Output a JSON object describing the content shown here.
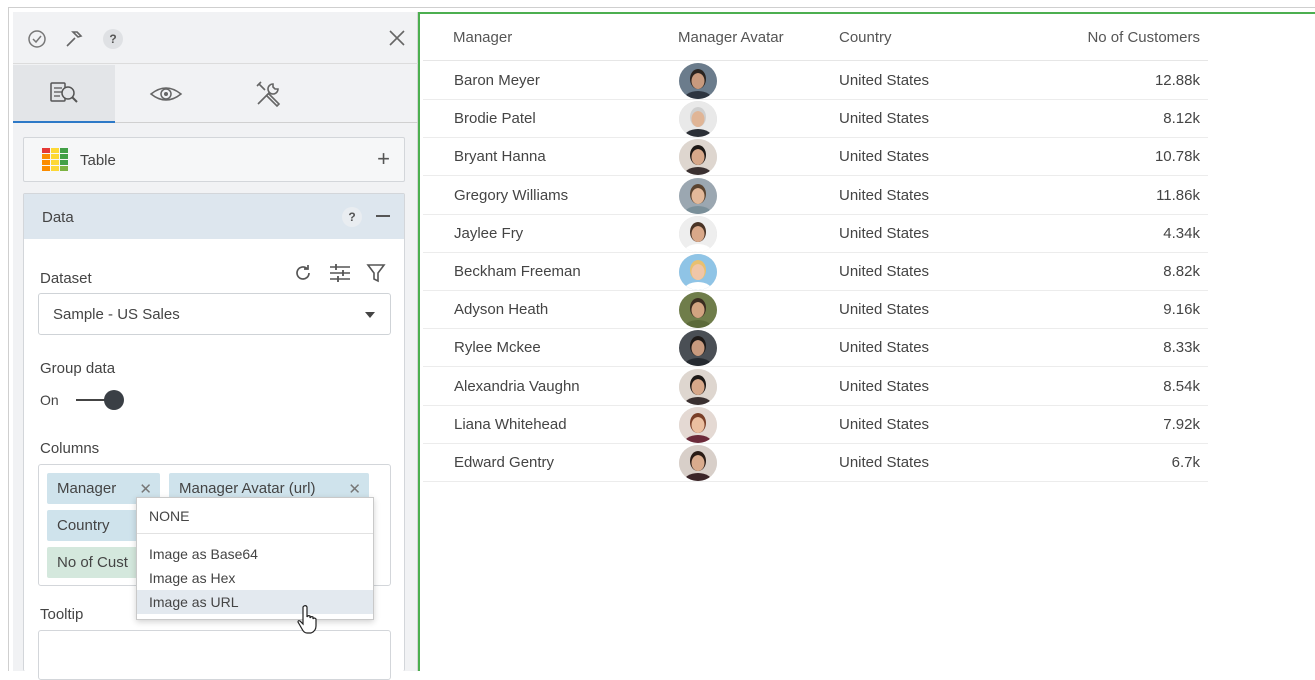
{
  "editor": {
    "table_card_label": "Table",
    "data_section_label": "Data",
    "data_help": "?",
    "topbar_help": "?",
    "dataset_label": "Dataset",
    "dataset_value": "Sample - US Sales",
    "group_data_label": "Group data",
    "group_data_state": "On",
    "columns_label": "Columns",
    "column_chips": [
      "Manager",
      "Manager Avatar (url)",
      "Country",
      "No of Cust"
    ],
    "tooltip_label": "Tooltip",
    "dropdown_menu": {
      "items": [
        "NONE",
        "Image as Base64",
        "Image as Hex",
        "Image as URL"
      ],
      "highlighted": "Image as URL"
    }
  },
  "table": {
    "headers": [
      "Manager",
      "Manager Avatar",
      "Country",
      "No of Customers"
    ],
    "rows": [
      {
        "manager": "Baron Meyer",
        "country": "United States",
        "customers": "12.88k",
        "avatar": "man-dark-suit"
      },
      {
        "manager": "Brodie Patel",
        "country": "United States",
        "customers": "8.12k",
        "avatar": "man-grey-hair"
      },
      {
        "manager": "Bryant Hanna",
        "country": "United States",
        "customers": "10.78k",
        "avatar": "woman-dark-hair"
      },
      {
        "manager": "Gregory Williams",
        "country": "United States",
        "customers": "11.86k",
        "avatar": "man-smiling"
      },
      {
        "manager": "Jaylee Fry",
        "country": "United States",
        "customers": "4.34k",
        "avatar": "man-beard"
      },
      {
        "manager": "Beckham Freeman",
        "country": "United States",
        "customers": "8.82k",
        "avatar": "woman-blonde"
      },
      {
        "manager": "Adyson Heath",
        "country": "United States",
        "customers": "9.16k",
        "avatar": "man-outdoor"
      },
      {
        "manager": "Rylee Mckee",
        "country": "United States",
        "customers": "8.33k",
        "avatar": "man-suit"
      },
      {
        "manager": "Alexandria Vaughn",
        "country": "United States",
        "customers": "8.54k",
        "avatar": "woman-dark-hair"
      },
      {
        "manager": "Liana Whitehead",
        "country": "United States",
        "customers": "7.92k",
        "avatar": "woman-red-hair"
      },
      {
        "manager": "Edward Gentry",
        "country": "United States",
        "customers": "6.7k",
        "avatar": "woman-brunette"
      }
    ]
  },
  "colors": {
    "accent_blue": "#2d79c7",
    "selection_border": "#4caf50",
    "chip_blue": "#cfe3ec",
    "chip_green": "#d4e8dd"
  }
}
